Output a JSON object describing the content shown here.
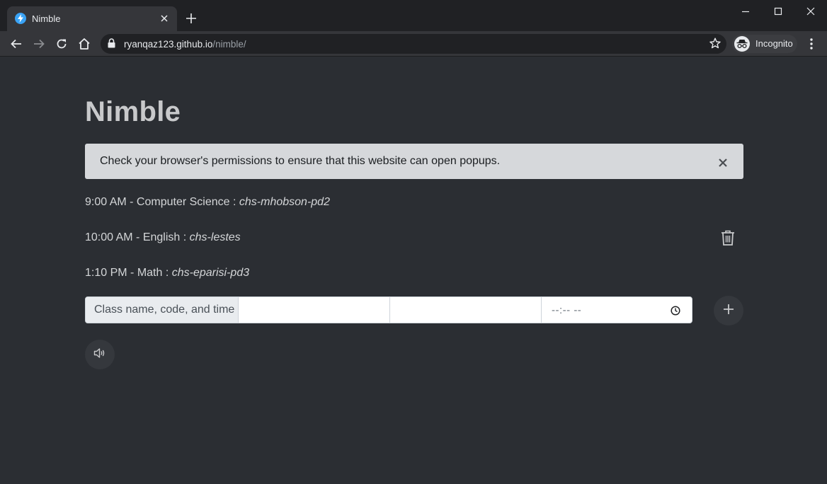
{
  "browser": {
    "tab_title": "Nimble",
    "url_host": "ryanqaz123.github.io",
    "url_path": "/nimble/",
    "profile_label": "Incognito"
  },
  "page": {
    "title": "Nimble",
    "alert_text": "Check your browser's permissions to ensure that this website can open popups."
  },
  "classes": [
    {
      "time": "9:00 AM",
      "name": "Computer Science",
      "code": "chs-mhobson-pd2"
    },
    {
      "time": "10:00 AM",
      "name": "English",
      "code": "chs-lestes"
    },
    {
      "time": "1:10 PM",
      "name": "Math",
      "code": "chs-eparisi-pd3"
    }
  ],
  "form": {
    "prepend_label": "Class name, code, and time",
    "name_value": "",
    "code_value": "",
    "time_placeholder": "--:-- --"
  },
  "colors": {
    "background": "#2b2e33",
    "alert_bg": "#d6d8db",
    "favicon": "#3aa3f5"
  },
  "icons": [
    "lightning-icon",
    "close-icon",
    "plus-icon",
    "back-icon",
    "forward-icon",
    "reload-icon",
    "home-icon",
    "lock-icon",
    "star-icon",
    "incognito-icon",
    "menu-icon",
    "trash-icon",
    "clock-icon",
    "speaker-icon"
  ]
}
